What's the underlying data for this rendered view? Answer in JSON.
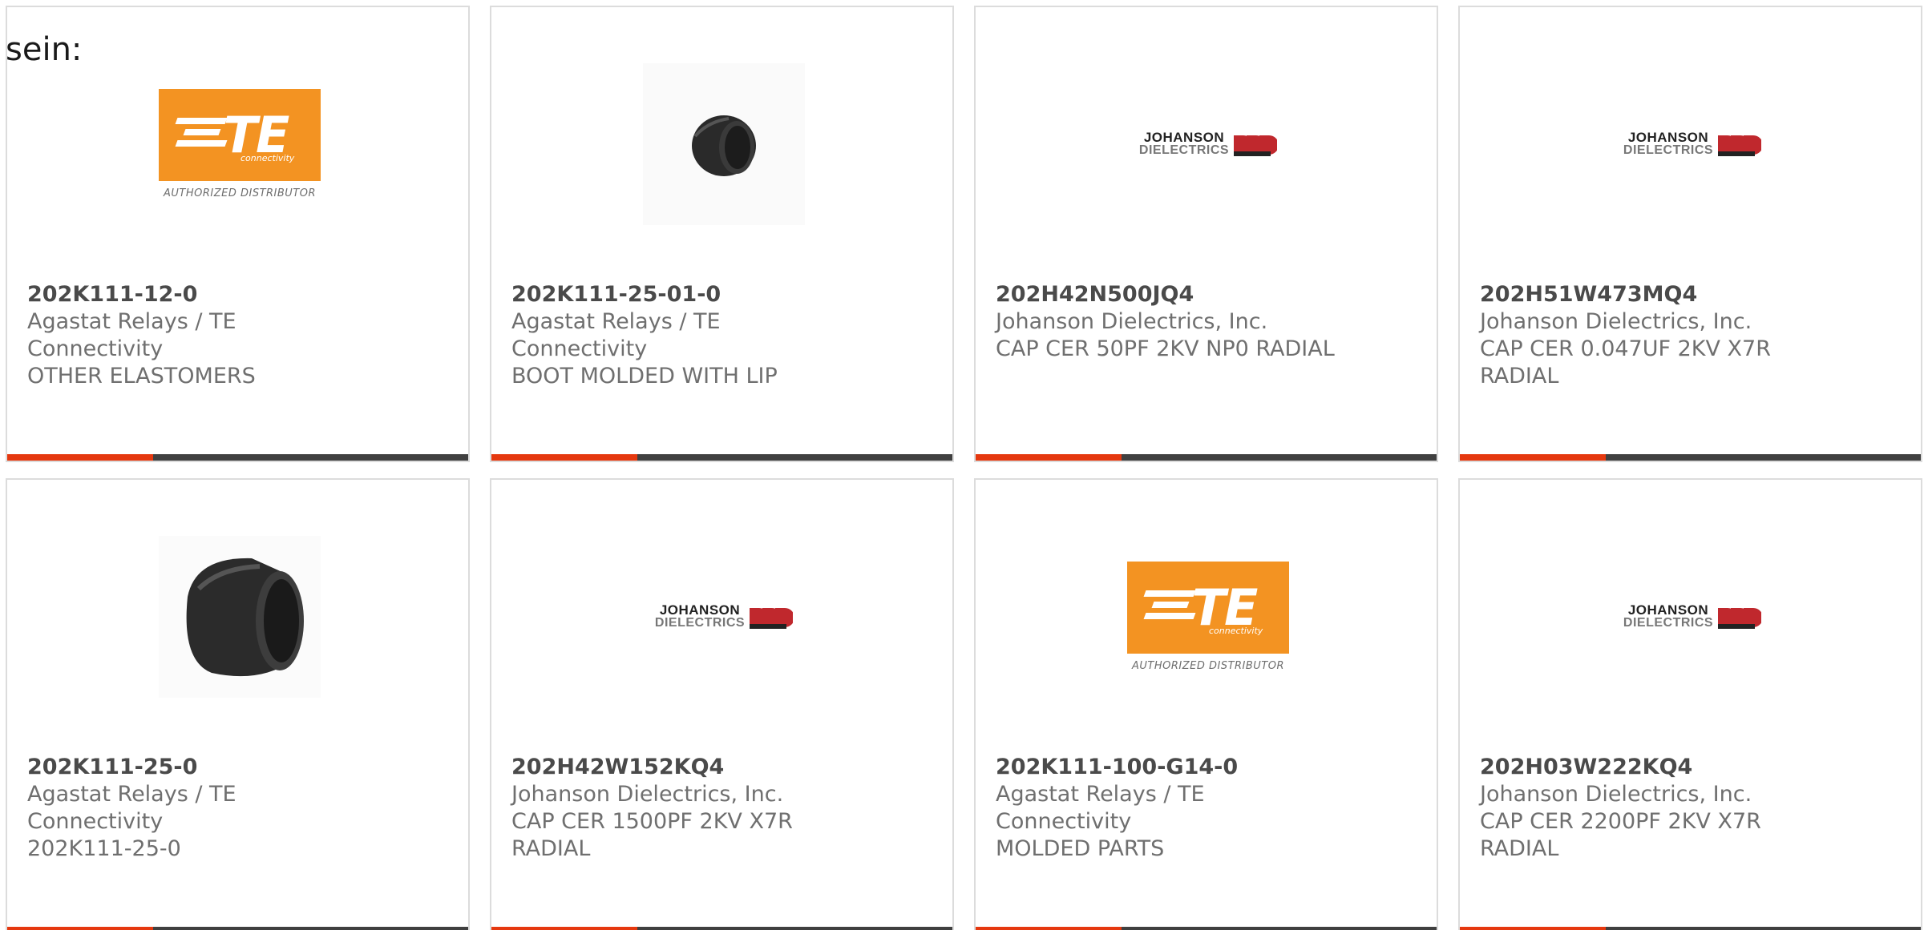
{
  "lead_text": "sein:",
  "colors": {
    "accent": "#e5380f",
    "bar": "#404040",
    "te_orange": "#f39322"
  },
  "products": [
    {
      "part_number": "202K111-12-0",
      "manufacturer": "Agastat Relays / TE Connectivity",
      "description": "OTHER ELASTOMERS",
      "image": "te-connectivity-logo-icon"
    },
    {
      "part_number": "202K111-25-01-0",
      "manufacturer": "Agastat Relays / TE Connectivity",
      "description": "BOOT MOLDED WITH LIP",
      "image": "boot-small-icon"
    },
    {
      "part_number": "202H42N500JQ4",
      "manufacturer": "Johanson Dielectrics, Inc.",
      "description": "CAP CER 50PF 2KV NP0 RADIAL",
      "image": "johanson-logo-icon"
    },
    {
      "part_number": "202H51W473MQ4",
      "manufacturer": "Johanson Dielectrics, Inc.",
      "description": "CAP CER 0.047UF 2KV X7R RADIAL",
      "image": "johanson-logo-icon"
    },
    {
      "part_number": "202K111-25-0",
      "manufacturer": "Agastat Relays / TE Connectivity",
      "description": "202K111-25-0",
      "image": "boot-large-icon"
    },
    {
      "part_number": "202H42W152KQ4",
      "manufacturer": "Johanson Dielectrics, Inc.",
      "description": "CAP CER 1500PF 2KV X7R RADIAL",
      "image": "johanson-logo-icon"
    },
    {
      "part_number": "202K111-100-G14-0",
      "manufacturer": "Agastat Relays / TE Connectivity",
      "description": "MOLDED PARTS",
      "image": "te-connectivity-logo-icon"
    },
    {
      "part_number": "202H03W222KQ4",
      "manufacturer": "Johanson Dielectrics, Inc.",
      "description": "CAP CER 2200PF 2KV X7R RADIAL",
      "image": "johanson-logo-icon"
    }
  ],
  "logos": {
    "te": {
      "wordmark": "TE",
      "sub": "connectivity",
      "tagline": "AUTHORIZED DISTRIBUTOR"
    },
    "johanson": {
      "line1": "JOHANSON",
      "line2": "DIELECTRICS"
    }
  }
}
